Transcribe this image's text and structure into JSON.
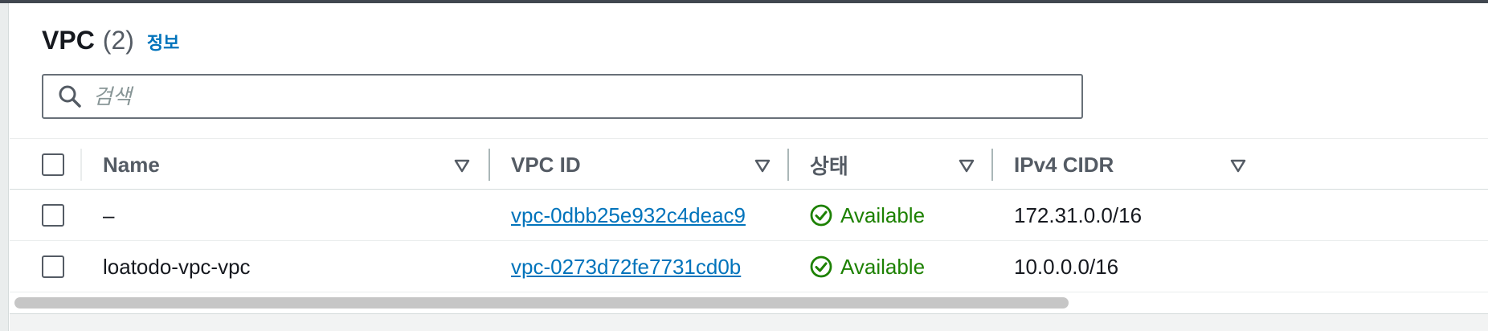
{
  "header": {
    "title": "VPC",
    "count": "(2)",
    "info_label": "정보"
  },
  "search": {
    "placeholder": "검색",
    "icon": "search-icon"
  },
  "table": {
    "columns": [
      {
        "label": "Name"
      },
      {
        "label": "VPC ID"
      },
      {
        "label": "상태"
      },
      {
        "label": "IPv4 CIDR"
      }
    ],
    "rows": [
      {
        "name": "–",
        "vpc_id": "vpc-0dbb25e932c4deac9",
        "status": "Available",
        "cidr": "172.31.0.0/16"
      },
      {
        "name": "loatodo-vpc-vpc",
        "vpc_id": "vpc-0273d72fe7731cd0b",
        "status": "Available",
        "cidr": "10.0.0.0/16"
      }
    ]
  },
  "colors": {
    "link": "#0073bb",
    "success": "#1d8102",
    "header_text": "#545b64"
  }
}
